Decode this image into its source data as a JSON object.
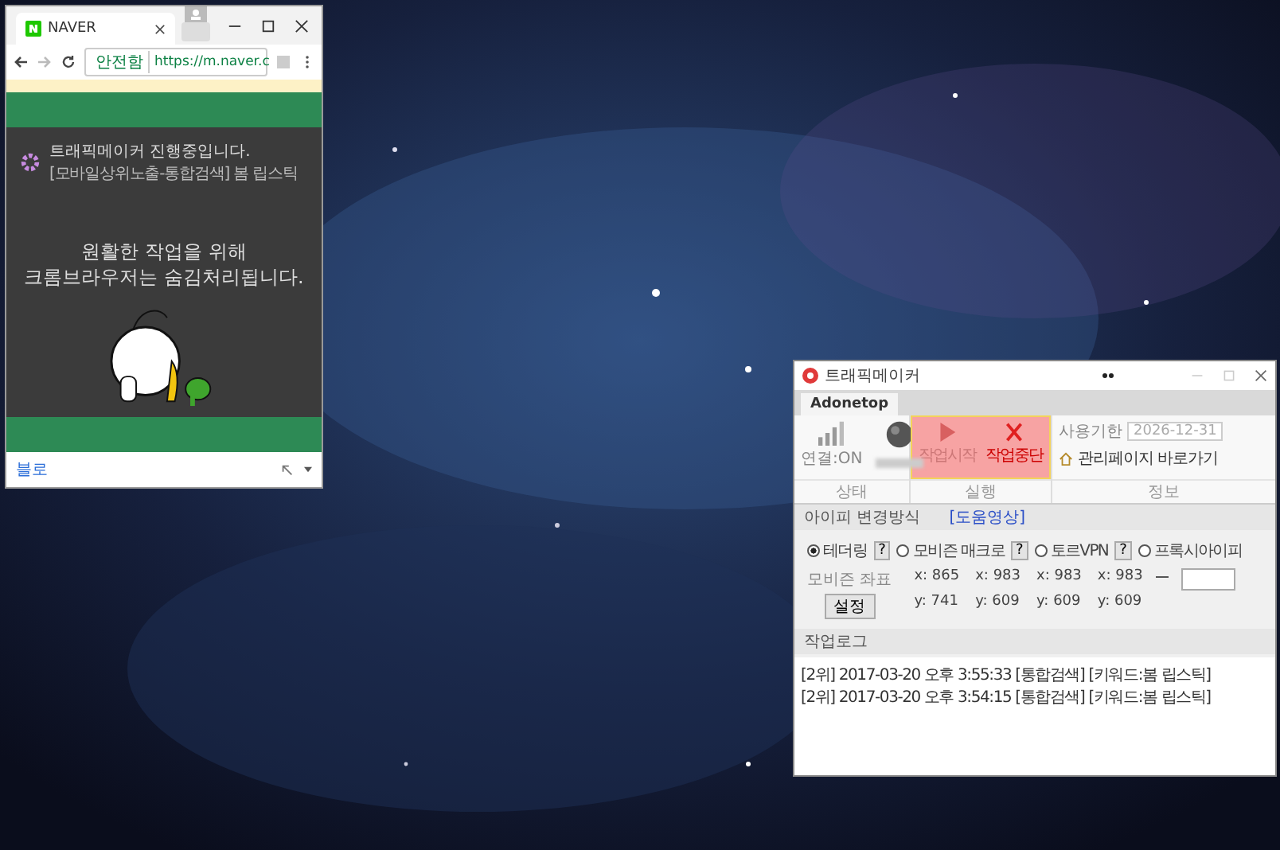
{
  "browser_window": {
    "tab_title": "NAVER",
    "security_label": "안전함",
    "url": "https://m.naver.c",
    "status_title": "트래픽메이커 진행중입니다.",
    "status_detail": "[모바일상위노출-통합검색] 봄 립스틱",
    "message_lines": [
      "원활한 작업을 위해",
      "크롬브라우저는 숨김처리됩니다."
    ],
    "bottom_link": "블로"
  },
  "app_window": {
    "title": "트래픽메이커",
    "tabs": [
      {
        "label": "Adonetop",
        "selected": true
      }
    ],
    "connection": "연결:ON",
    "actions": [
      {
        "kind": "start",
        "label": "작업시작",
        "disabled": true
      },
      {
        "kind": "stop",
        "label": "작업중단",
        "disabled": false
      }
    ],
    "expiry_label": "사용기한",
    "expiry_date": "2026-12-31",
    "admin_link": "관리페이지 바로가기",
    "groups": [
      "상태",
      "실행",
      "정보"
    ],
    "ip_section": {
      "title": "아이피 변경방식",
      "help_link": "[도움영상]",
      "options": [
        {
          "label": "테더링",
          "selected": true,
          "help": "?"
        },
        {
          "label": "모비즌 매크로",
          "selected": false,
          "help": "?"
        },
        {
          "label": "토르VPN",
          "selected": false,
          "help": "?"
        },
        {
          "label": "프록시아이피",
          "selected": false
        }
      ]
    },
    "coords": {
      "label": "모비즌 좌표",
      "button": "설정",
      "x": [
        "x: 865",
        "x: 983",
        "x: 983",
        "x: 983"
      ],
      "y": [
        "y: 741",
        "y: 609",
        "y: 609",
        "y: 609"
      ]
    },
    "log": {
      "title": "작업로그",
      "lines": [
        "[2위] 2017-03-20 오후 3:55:33  [통합검색] [키워드:봄 립스틱]",
        "[2위] 2017-03-20 오후 3:54:15  [통합검색] [키워드:봄 립스틱]"
      ]
    }
  }
}
